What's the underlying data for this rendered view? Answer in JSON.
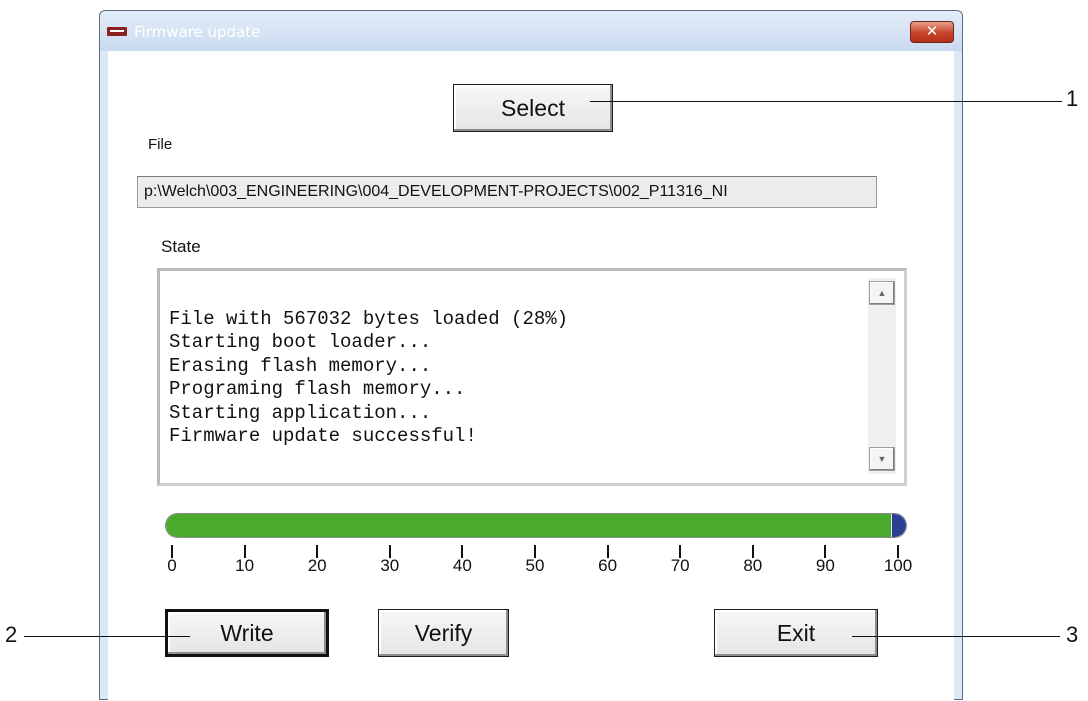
{
  "window": {
    "title": "Firmware update",
    "close_label": "✕"
  },
  "buttons": {
    "select": "Select",
    "write": "Write",
    "verify": "Verify",
    "exit": "Exit"
  },
  "file": {
    "label": "File",
    "value": "p:\\Welch\\003_ENGINEERING\\004_DEVELOPMENT-PROJECTS\\002_P11316_NI"
  },
  "state": {
    "label": "State",
    "lines": [
      "File with 567032 bytes loaded (28%)",
      "Starting boot loader...",
      "Erasing flash memory...",
      "Programing flash memory...",
      "Starting application...",
      "Firmware update successful!"
    ]
  },
  "scrollbar": {
    "up_arrow": "▲",
    "down_arrow": "▼"
  },
  "progress": {
    "value_percent": 98,
    "ticks": [
      "0",
      "10",
      "20",
      "30",
      "40",
      "50",
      "60",
      "70",
      "80",
      "90",
      "100"
    ]
  },
  "callouts": [
    "1",
    "2",
    "3"
  ],
  "colors": {
    "progress_fill": "#4aaa2b",
    "progress_end": "#2c3e91",
    "close_button": "#c7432a"
  }
}
